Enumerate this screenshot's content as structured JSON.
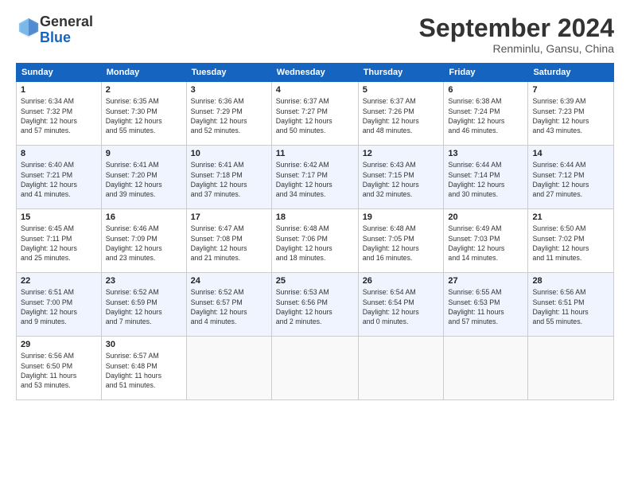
{
  "header": {
    "logo_general": "General",
    "logo_blue": "Blue",
    "month_title": "September 2024",
    "location": "Renminlu, Gansu, China"
  },
  "calendar": {
    "headers": [
      "Sunday",
      "Monday",
      "Tuesday",
      "Wednesday",
      "Thursday",
      "Friday",
      "Saturday"
    ],
    "weeks": [
      [
        {
          "day": "",
          "info": ""
        },
        {
          "day": "2",
          "info": "Sunrise: 6:35 AM\nSunset: 7:30 PM\nDaylight: 12 hours\nand 55 minutes."
        },
        {
          "day": "3",
          "info": "Sunrise: 6:36 AM\nSunset: 7:29 PM\nDaylight: 12 hours\nand 52 minutes."
        },
        {
          "day": "4",
          "info": "Sunrise: 6:37 AM\nSunset: 7:27 PM\nDaylight: 12 hours\nand 50 minutes."
        },
        {
          "day": "5",
          "info": "Sunrise: 6:37 AM\nSunset: 7:26 PM\nDaylight: 12 hours\nand 48 minutes."
        },
        {
          "day": "6",
          "info": "Sunrise: 6:38 AM\nSunset: 7:24 PM\nDaylight: 12 hours\nand 46 minutes."
        },
        {
          "day": "7",
          "info": "Sunrise: 6:39 AM\nSunset: 7:23 PM\nDaylight: 12 hours\nand 43 minutes."
        }
      ],
      [
        {
          "day": "1",
          "info": "Sunrise: 6:34 AM\nSunset: 7:32 PM\nDaylight: 12 hours\nand 57 minutes."
        },
        {
          "day": "",
          "info": ""
        },
        {
          "day": "",
          "info": ""
        },
        {
          "day": "",
          "info": ""
        },
        {
          "day": "",
          "info": ""
        },
        {
          "day": "",
          "info": ""
        },
        {
          "day": "",
          "info": ""
        }
      ],
      [
        {
          "day": "8",
          "info": "Sunrise: 6:40 AM\nSunset: 7:21 PM\nDaylight: 12 hours\nand 41 minutes."
        },
        {
          "day": "9",
          "info": "Sunrise: 6:41 AM\nSunset: 7:20 PM\nDaylight: 12 hours\nand 39 minutes."
        },
        {
          "day": "10",
          "info": "Sunrise: 6:41 AM\nSunset: 7:18 PM\nDaylight: 12 hours\nand 37 minutes."
        },
        {
          "day": "11",
          "info": "Sunrise: 6:42 AM\nSunset: 7:17 PM\nDaylight: 12 hours\nand 34 minutes."
        },
        {
          "day": "12",
          "info": "Sunrise: 6:43 AM\nSunset: 7:15 PM\nDaylight: 12 hours\nand 32 minutes."
        },
        {
          "day": "13",
          "info": "Sunrise: 6:44 AM\nSunset: 7:14 PM\nDaylight: 12 hours\nand 30 minutes."
        },
        {
          "day": "14",
          "info": "Sunrise: 6:44 AM\nSunset: 7:12 PM\nDaylight: 12 hours\nand 27 minutes."
        }
      ],
      [
        {
          "day": "15",
          "info": "Sunrise: 6:45 AM\nSunset: 7:11 PM\nDaylight: 12 hours\nand 25 minutes."
        },
        {
          "day": "16",
          "info": "Sunrise: 6:46 AM\nSunset: 7:09 PM\nDaylight: 12 hours\nand 23 minutes."
        },
        {
          "day": "17",
          "info": "Sunrise: 6:47 AM\nSunset: 7:08 PM\nDaylight: 12 hours\nand 21 minutes."
        },
        {
          "day": "18",
          "info": "Sunrise: 6:48 AM\nSunset: 7:06 PM\nDaylight: 12 hours\nand 18 minutes."
        },
        {
          "day": "19",
          "info": "Sunrise: 6:48 AM\nSunset: 7:05 PM\nDaylight: 12 hours\nand 16 minutes."
        },
        {
          "day": "20",
          "info": "Sunrise: 6:49 AM\nSunset: 7:03 PM\nDaylight: 12 hours\nand 14 minutes."
        },
        {
          "day": "21",
          "info": "Sunrise: 6:50 AM\nSunset: 7:02 PM\nDaylight: 12 hours\nand 11 minutes."
        }
      ],
      [
        {
          "day": "22",
          "info": "Sunrise: 6:51 AM\nSunset: 7:00 PM\nDaylight: 12 hours\nand 9 minutes."
        },
        {
          "day": "23",
          "info": "Sunrise: 6:52 AM\nSunset: 6:59 PM\nDaylight: 12 hours\nand 7 minutes."
        },
        {
          "day": "24",
          "info": "Sunrise: 6:52 AM\nSunset: 6:57 PM\nDaylight: 12 hours\nand 4 minutes."
        },
        {
          "day": "25",
          "info": "Sunrise: 6:53 AM\nSunset: 6:56 PM\nDaylight: 12 hours\nand 2 minutes."
        },
        {
          "day": "26",
          "info": "Sunrise: 6:54 AM\nSunset: 6:54 PM\nDaylight: 12 hours\nand 0 minutes."
        },
        {
          "day": "27",
          "info": "Sunrise: 6:55 AM\nSunset: 6:53 PM\nDaylight: 11 hours\nand 57 minutes."
        },
        {
          "day": "28",
          "info": "Sunrise: 6:56 AM\nSunset: 6:51 PM\nDaylight: 11 hours\nand 55 minutes."
        }
      ],
      [
        {
          "day": "29",
          "info": "Sunrise: 6:56 AM\nSunset: 6:50 PM\nDaylight: 11 hours\nand 53 minutes."
        },
        {
          "day": "30",
          "info": "Sunrise: 6:57 AM\nSunset: 6:48 PM\nDaylight: 11 hours\nand 51 minutes."
        },
        {
          "day": "",
          "info": ""
        },
        {
          "day": "",
          "info": ""
        },
        {
          "day": "",
          "info": ""
        },
        {
          "day": "",
          "info": ""
        },
        {
          "day": "",
          "info": ""
        }
      ]
    ]
  }
}
